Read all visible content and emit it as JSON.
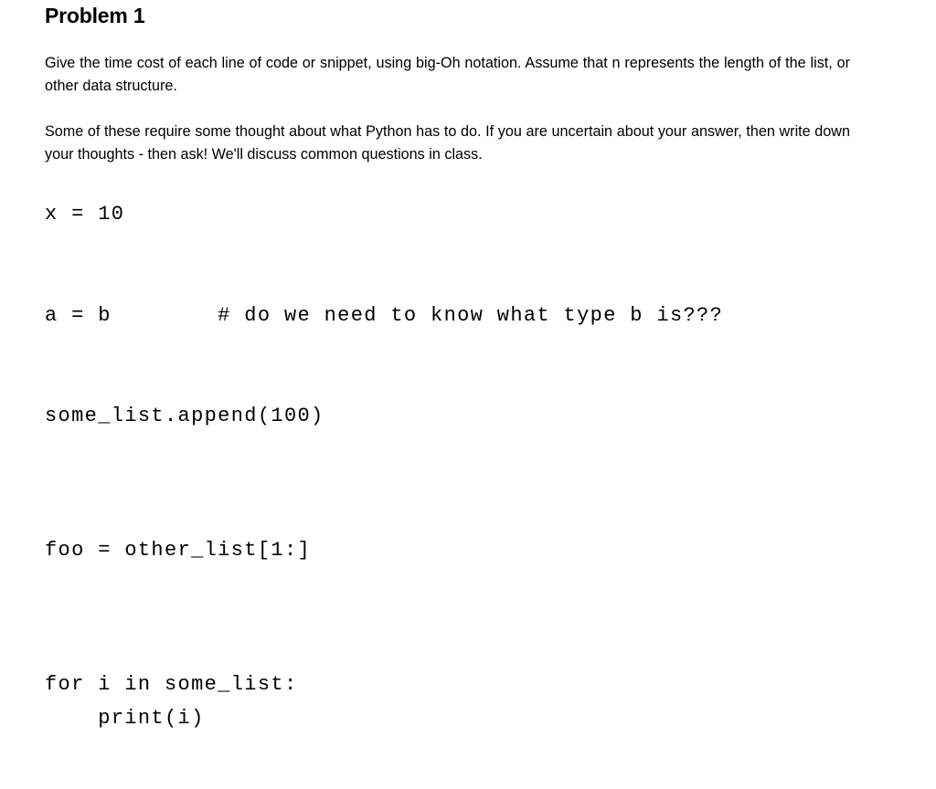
{
  "document": {
    "title": "Problem 1",
    "paragraphs": [
      "Give the time cost of each line of code or snippet, using big-Oh notation.  Assume that n represents the length of the list, or other data structure.",
      "Some of these require some thought about what Python has to do.  If you are uncertain about your answer, then write down your thoughts - then ask!  We'll discuss common questions in class."
    ],
    "code_snippets": [
      {
        "id": "snippet-assignment-literal",
        "text": "x = 10"
      },
      {
        "id": "snippet-assignment-variable",
        "text": "a = b        # do we need to know what type b is???"
      },
      {
        "id": "snippet-list-append",
        "text": "some_list.append(100)"
      },
      {
        "id": "snippet-list-slice",
        "text": "foo = other_list[1:]"
      },
      {
        "id": "snippet-for-loop",
        "text": "for i in some_list:\n    print(i)"
      }
    ],
    "colors": {
      "background": "#ffffff",
      "text": "#000000"
    }
  }
}
